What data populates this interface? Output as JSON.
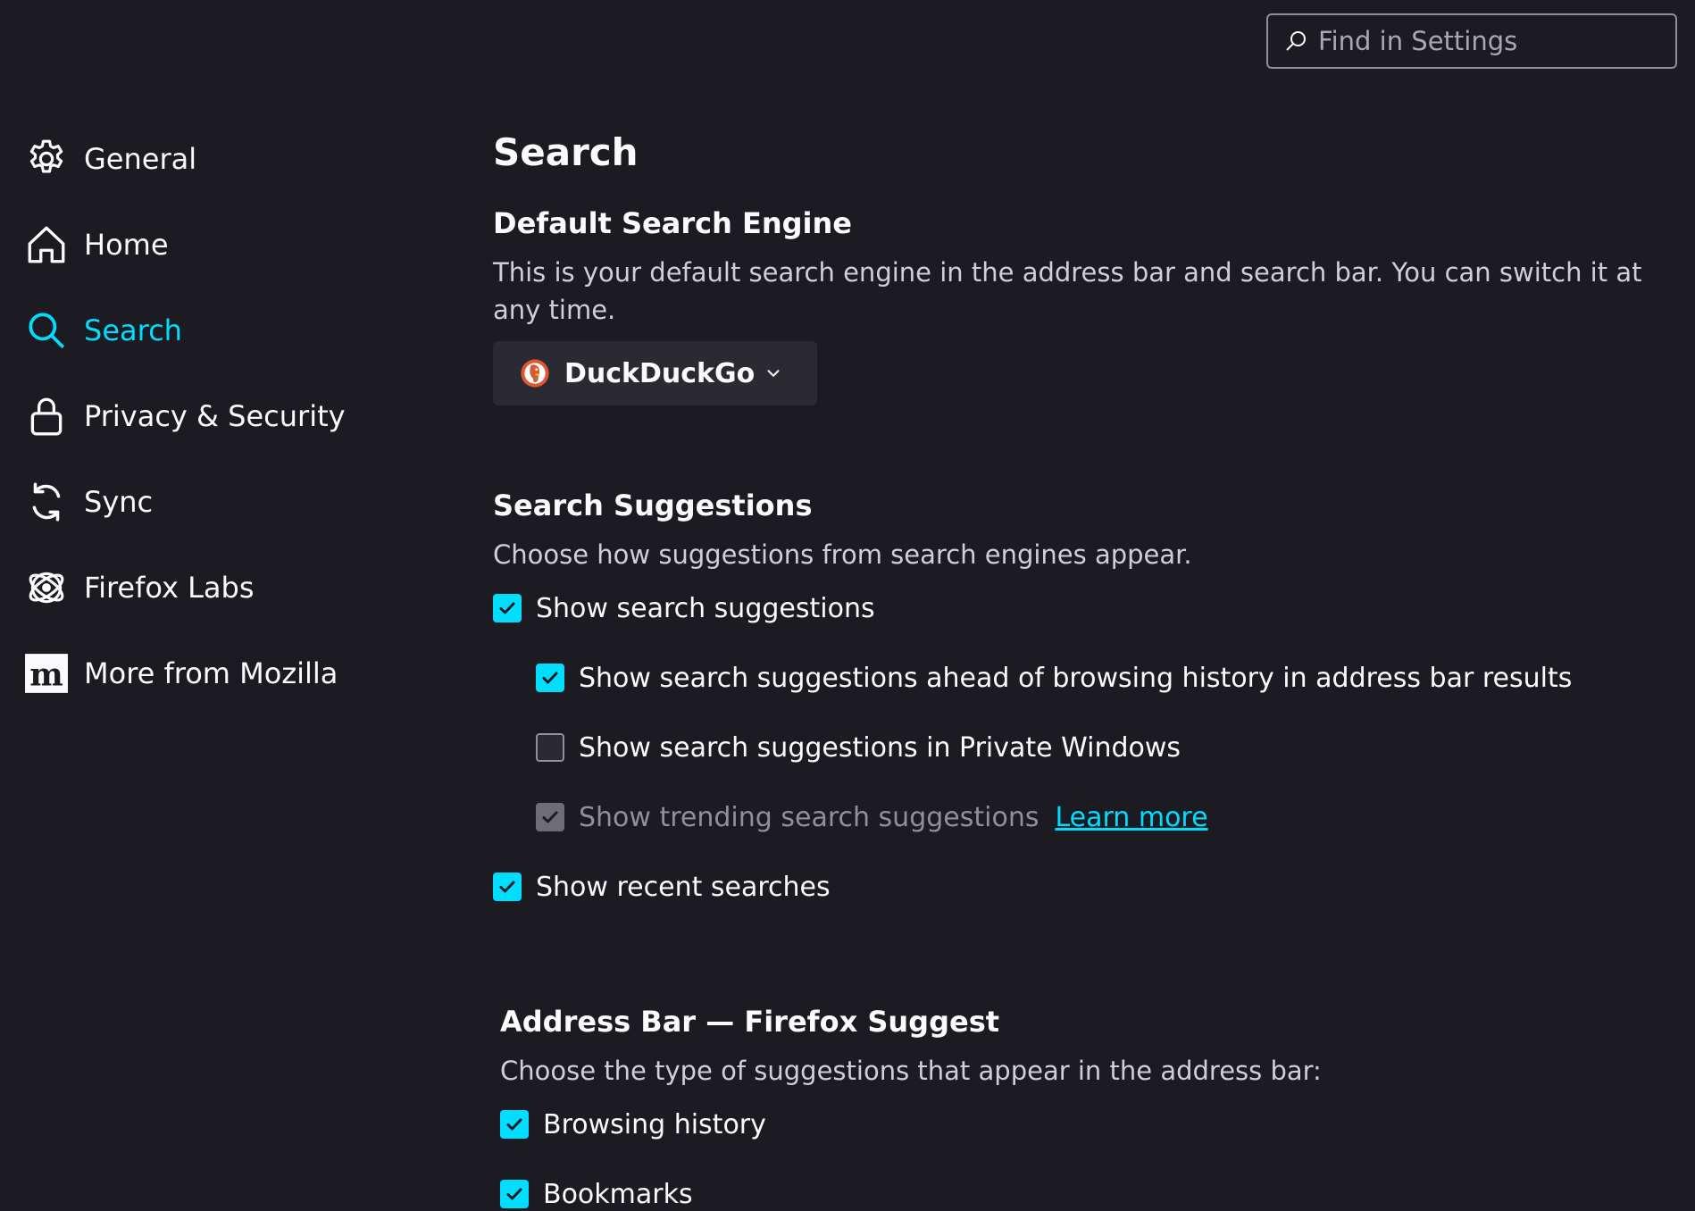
{
  "header": {
    "find_placeholder": "Find in Settings"
  },
  "sidebar": {
    "items": [
      {
        "label": "General",
        "icon": "gear-icon"
      },
      {
        "label": "Home",
        "icon": "home-icon"
      },
      {
        "label": "Search",
        "icon": "search-icon",
        "active": true
      },
      {
        "label": "Privacy & Security",
        "icon": "lock-icon"
      },
      {
        "label": "Sync",
        "icon": "sync-icon"
      },
      {
        "label": "Firefox Labs",
        "icon": "labs-icon"
      },
      {
        "label": "More from Mozilla",
        "icon": "mozilla-icon"
      }
    ]
  },
  "main": {
    "title": "Search",
    "default_engine": {
      "heading": "Default Search Engine",
      "description": "This is your default search engine in the address bar and search bar. You can switch it at any time.",
      "selected": "DuckDuckGo"
    },
    "suggestions": {
      "heading": "Search Suggestions",
      "description": "Choose how suggestions from search engines appear.",
      "show_suggestions": {
        "label": "Show search suggestions",
        "checked": true
      },
      "ahead_of_history": {
        "label": "Show search suggestions ahead of browsing history in address bar results",
        "checked": true
      },
      "private_windows": {
        "label": "Show search suggestions in Private Windows",
        "checked": false
      },
      "trending": {
        "label": "Show trending search suggestions",
        "checked": true,
        "disabled": true,
        "link": "Learn more"
      },
      "recent": {
        "label": "Show recent searches",
        "checked": true
      }
    },
    "address_bar": {
      "heading": "Address Bar — Firefox Suggest",
      "description": "Choose the type of suggestions that appear in the address bar:",
      "browsing_history": {
        "label": "Browsing history",
        "checked": true
      },
      "bookmarks": {
        "label": "Bookmarks",
        "checked": true
      }
    }
  },
  "colors": {
    "background": "#1c1b22",
    "accent": "#00ddff",
    "text": "#fbfbfe",
    "muted": "#cfcfd8"
  }
}
